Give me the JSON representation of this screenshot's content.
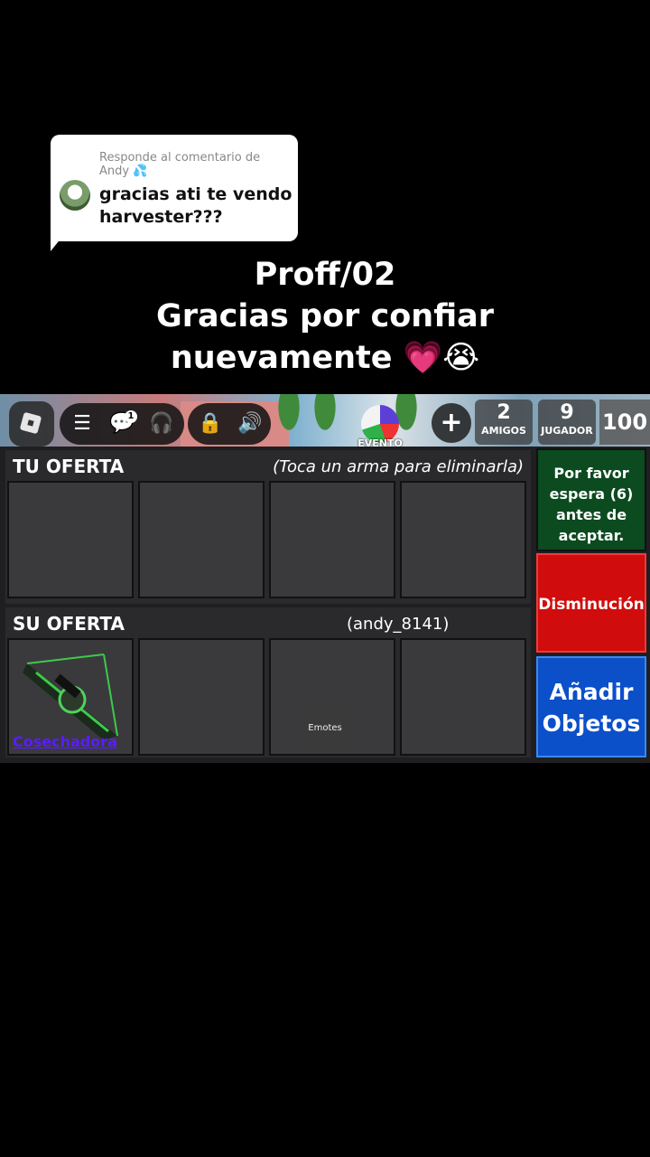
{
  "reply": {
    "header": "Responde al comentario de Andy 💦",
    "comment": "gracias ati te vendo harvester???"
  },
  "caption": {
    "line1": "Proff/02",
    "line2": "Gracias por confiar",
    "line3": "nuevamente 💗😭"
  },
  "topbar": {
    "notification_count": "1",
    "event_label": "EVENTO",
    "friends_count": "2",
    "friends_label": "AMIGOS",
    "players_count": "9",
    "players_label": "JUGADOR",
    "level_value": "100"
  },
  "trade": {
    "your_offer_title": "TU OFERTA",
    "your_offer_hint": "(Toca un arma para eliminarla)",
    "their_offer_title": "SU OFERTA",
    "their_username": "(andy_8141)",
    "their_items": [
      {
        "name": "Cosechadora",
        "icon": "crossbow-icon"
      }
    ],
    "emotes_label": "Emotes",
    "wait_message": "Por favor espera (6) antes de aceptar.",
    "decline_label": "Disminución",
    "add_items_label": "Añadir Objetos"
  },
  "colors": {
    "wait_bg": "#0c4a1f",
    "decline_bg": "#d10c0c",
    "add_bg": "#0b4fc9",
    "item_name": "#5a1cff"
  }
}
